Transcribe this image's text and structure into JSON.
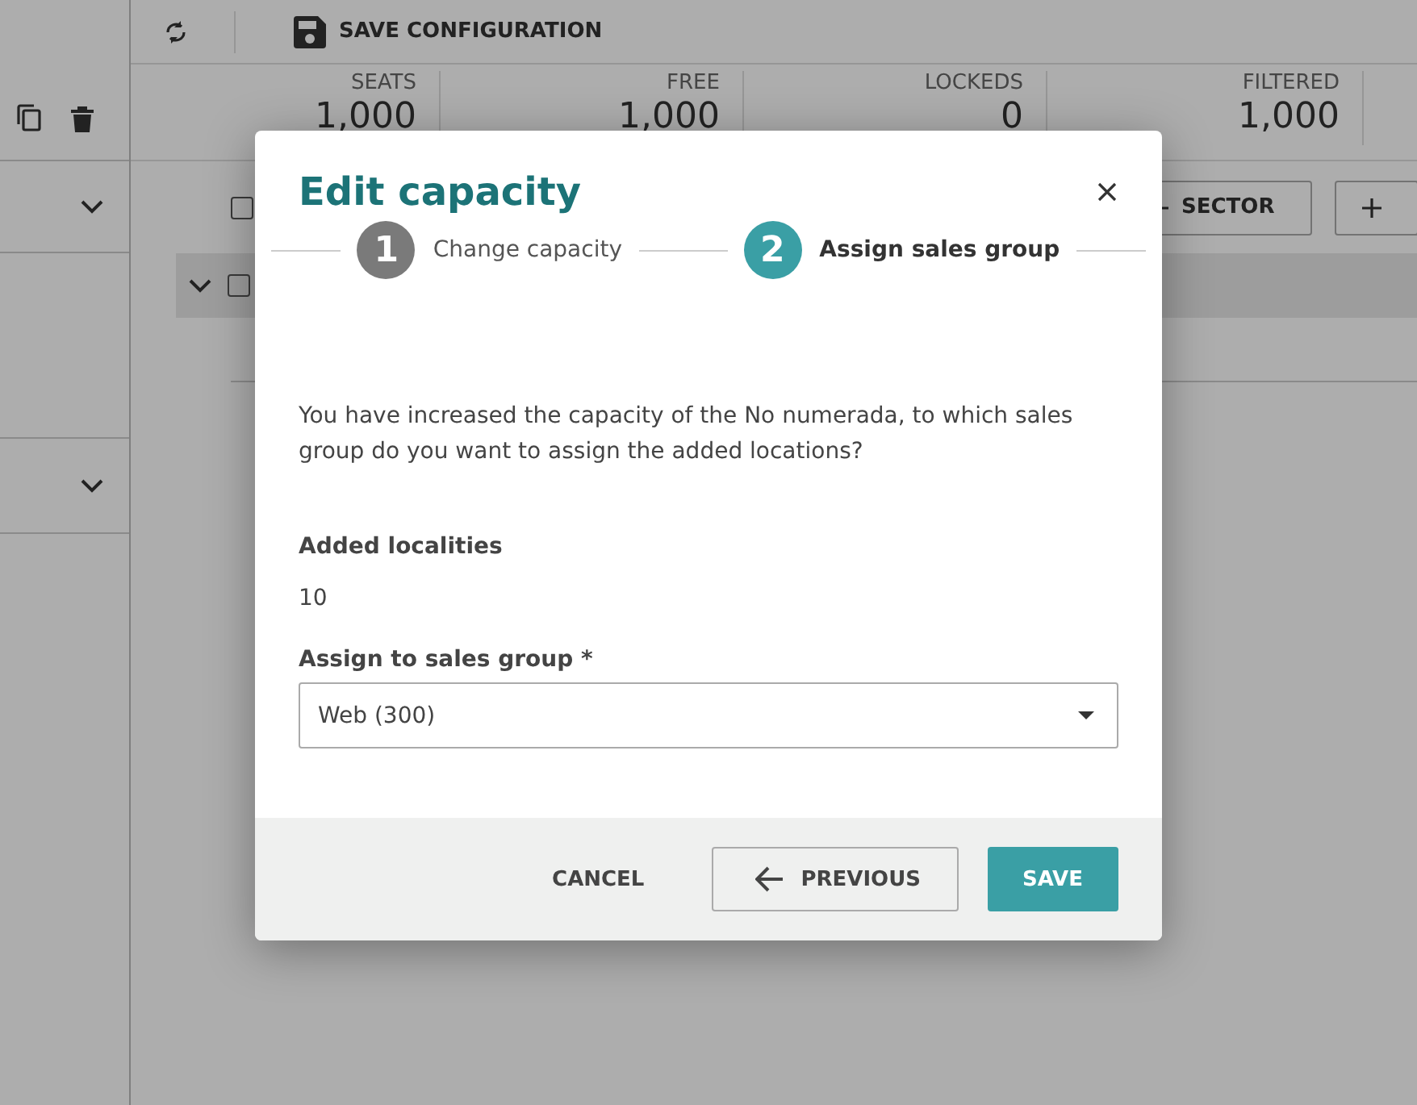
{
  "toolbar": {
    "save_label": "SAVE CONFIGURATION"
  },
  "stats": [
    {
      "label": "SEATS",
      "value": "1,000"
    },
    {
      "label": "FREE",
      "value": "1,000"
    },
    {
      "label": "LOCKEDS",
      "value": "0"
    },
    {
      "label": "FILTERED",
      "value": "1,000"
    }
  ],
  "actions": [
    {
      "label": "SECTOR"
    }
  ],
  "checkboxes": [
    {
      "checked": false
    },
    {
      "checked": false
    }
  ],
  "dialog": {
    "title": "Edit capacity",
    "steps": [
      {
        "number": "1",
        "label": "Change capacity",
        "active": false
      },
      {
        "number": "2",
        "label": "Assign sales group",
        "active": true
      }
    ],
    "message": "You have increased the capacity of the No numerada, to which sales group do you want to assign the added locations?",
    "added_label": "Added localities",
    "added_value": "10",
    "select": {
      "label": "Assign to sales group *",
      "value": "Web (300)"
    },
    "buttons": [
      {
        "kind": "text",
        "label": "CANCEL"
      },
      {
        "kind": "back",
        "label": "PREVIOUS"
      },
      {
        "kind": "primary",
        "label": "SAVE"
      }
    ]
  }
}
